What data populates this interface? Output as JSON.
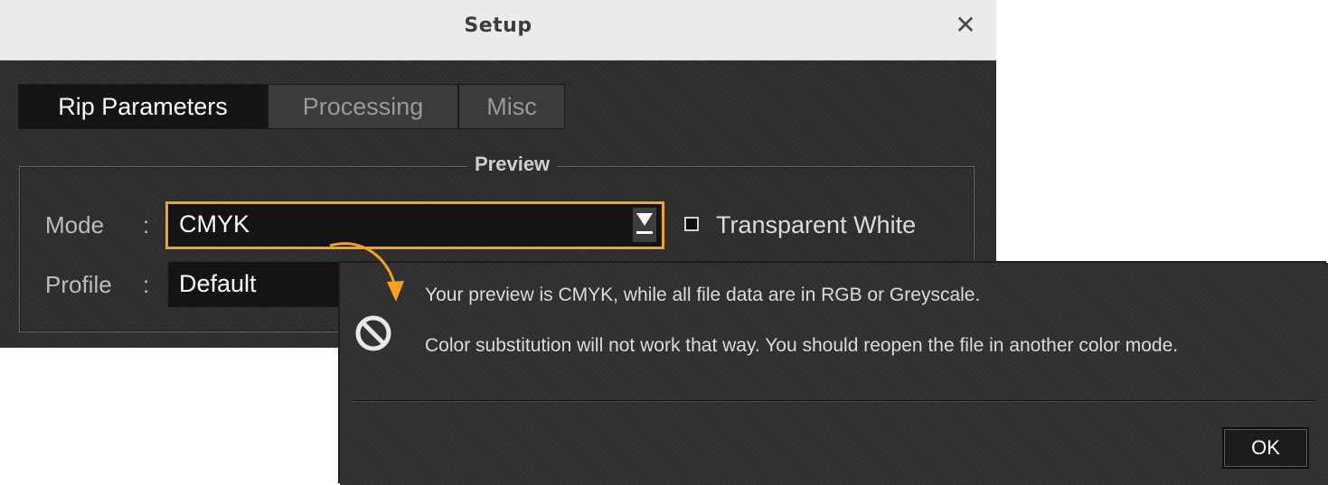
{
  "setup_window": {
    "title": "Setup",
    "close_icon": "close-icon"
  },
  "tabs": [
    {
      "label": "Rip Parameters",
      "active": true
    },
    {
      "label": "Processing",
      "active": false
    },
    {
      "label": "Misc",
      "active": false
    }
  ],
  "preview": {
    "legend": "Preview",
    "mode_label": "Mode",
    "mode_colon": ":",
    "mode_value": "CMYK",
    "profile_label": "Profile",
    "profile_colon": ":",
    "profile_value": "Default",
    "transparent_white_label": "Transparent White",
    "transparent_white_checked": false
  },
  "warning_dialog": {
    "icon": "prohibited-icon",
    "message_line_1": "Your preview is CMYK, while all file data are in RGB or Greyscale.",
    "message_line_2": "Color substitution will not work that way. You should reopen the file in another color mode.",
    "ok_label": "OK"
  },
  "colors": {
    "highlight": "#f7a11e",
    "window_bg": "#2e2e2e",
    "titlebar_bg": "#ebebeb"
  }
}
